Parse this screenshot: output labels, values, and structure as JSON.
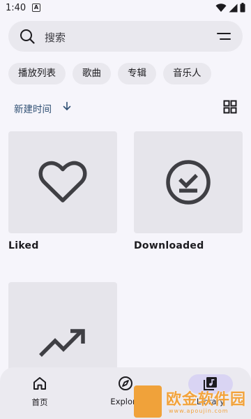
{
  "status": {
    "time": "1:40",
    "notification_icon": "A"
  },
  "search": {
    "placeholder": "搜索"
  },
  "chips": [
    "播放列表",
    "歌曲",
    "专辑",
    "音乐人"
  ],
  "sort": {
    "label": "新建时间"
  },
  "cards": [
    {
      "title": "Liked",
      "icon": "heart-icon"
    },
    {
      "title": "Downloaded",
      "icon": "download-done-icon"
    },
    {
      "title": "",
      "icon": "trending-up-icon"
    }
  ],
  "nav": {
    "items": [
      {
        "label": "首页",
        "icon": "home-icon"
      },
      {
        "label": "Explore",
        "icon": "explore-icon"
      },
      {
        "label": "Library",
        "icon": "library-music-icon",
        "selected": true
      }
    ]
  },
  "watermark": {
    "text": "欧金软件园",
    "url": "www.apoujin.com"
  },
  "colors": {
    "background": "#f6f5fb",
    "surface": "#e9e8ee",
    "accent_pill": "#d9d4f3",
    "sort_text": "#2f4f73",
    "watermark": "#f2a33c"
  }
}
